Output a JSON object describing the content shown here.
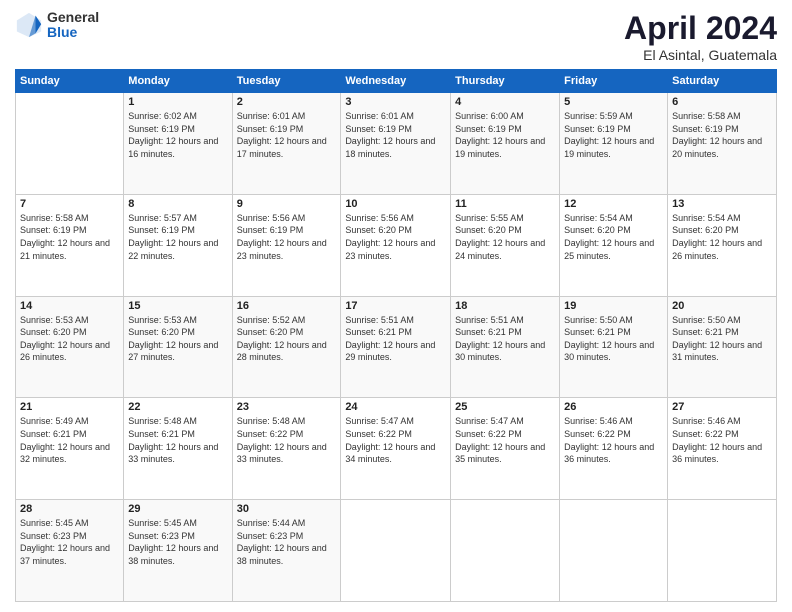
{
  "logo": {
    "general": "General",
    "blue": "Blue"
  },
  "header": {
    "title": "April 2024",
    "location": "El Asintal, Guatemala"
  },
  "weekdays": [
    "Sunday",
    "Monday",
    "Tuesday",
    "Wednesday",
    "Thursday",
    "Friday",
    "Saturday"
  ],
  "weeks": [
    [
      {
        "day": "",
        "sunrise": "",
        "sunset": "",
        "daylight": ""
      },
      {
        "day": "1",
        "sunrise": "Sunrise: 6:02 AM",
        "sunset": "Sunset: 6:19 PM",
        "daylight": "Daylight: 12 hours and 16 minutes."
      },
      {
        "day": "2",
        "sunrise": "Sunrise: 6:01 AM",
        "sunset": "Sunset: 6:19 PM",
        "daylight": "Daylight: 12 hours and 17 minutes."
      },
      {
        "day": "3",
        "sunrise": "Sunrise: 6:01 AM",
        "sunset": "Sunset: 6:19 PM",
        "daylight": "Daylight: 12 hours and 18 minutes."
      },
      {
        "day": "4",
        "sunrise": "Sunrise: 6:00 AM",
        "sunset": "Sunset: 6:19 PM",
        "daylight": "Daylight: 12 hours and 19 minutes."
      },
      {
        "day": "5",
        "sunrise": "Sunrise: 5:59 AM",
        "sunset": "Sunset: 6:19 PM",
        "daylight": "Daylight: 12 hours and 19 minutes."
      },
      {
        "day": "6",
        "sunrise": "Sunrise: 5:58 AM",
        "sunset": "Sunset: 6:19 PM",
        "daylight": "Daylight: 12 hours and 20 minutes."
      }
    ],
    [
      {
        "day": "7",
        "sunrise": "Sunrise: 5:58 AM",
        "sunset": "Sunset: 6:19 PM",
        "daylight": "Daylight: 12 hours and 21 minutes."
      },
      {
        "day": "8",
        "sunrise": "Sunrise: 5:57 AM",
        "sunset": "Sunset: 6:19 PM",
        "daylight": "Daylight: 12 hours and 22 minutes."
      },
      {
        "day": "9",
        "sunrise": "Sunrise: 5:56 AM",
        "sunset": "Sunset: 6:19 PM",
        "daylight": "Daylight: 12 hours and 23 minutes."
      },
      {
        "day": "10",
        "sunrise": "Sunrise: 5:56 AM",
        "sunset": "Sunset: 6:20 PM",
        "daylight": "Daylight: 12 hours and 23 minutes."
      },
      {
        "day": "11",
        "sunrise": "Sunrise: 5:55 AM",
        "sunset": "Sunset: 6:20 PM",
        "daylight": "Daylight: 12 hours and 24 minutes."
      },
      {
        "day": "12",
        "sunrise": "Sunrise: 5:54 AM",
        "sunset": "Sunset: 6:20 PM",
        "daylight": "Daylight: 12 hours and 25 minutes."
      },
      {
        "day": "13",
        "sunrise": "Sunrise: 5:54 AM",
        "sunset": "Sunset: 6:20 PM",
        "daylight": "Daylight: 12 hours and 26 minutes."
      }
    ],
    [
      {
        "day": "14",
        "sunrise": "Sunrise: 5:53 AM",
        "sunset": "Sunset: 6:20 PM",
        "daylight": "Daylight: 12 hours and 26 minutes."
      },
      {
        "day": "15",
        "sunrise": "Sunrise: 5:53 AM",
        "sunset": "Sunset: 6:20 PM",
        "daylight": "Daylight: 12 hours and 27 minutes."
      },
      {
        "day": "16",
        "sunrise": "Sunrise: 5:52 AM",
        "sunset": "Sunset: 6:20 PM",
        "daylight": "Daylight: 12 hours and 28 minutes."
      },
      {
        "day": "17",
        "sunrise": "Sunrise: 5:51 AM",
        "sunset": "Sunset: 6:21 PM",
        "daylight": "Daylight: 12 hours and 29 minutes."
      },
      {
        "day": "18",
        "sunrise": "Sunrise: 5:51 AM",
        "sunset": "Sunset: 6:21 PM",
        "daylight": "Daylight: 12 hours and 30 minutes."
      },
      {
        "day": "19",
        "sunrise": "Sunrise: 5:50 AM",
        "sunset": "Sunset: 6:21 PM",
        "daylight": "Daylight: 12 hours and 30 minutes."
      },
      {
        "day": "20",
        "sunrise": "Sunrise: 5:50 AM",
        "sunset": "Sunset: 6:21 PM",
        "daylight": "Daylight: 12 hours and 31 minutes."
      }
    ],
    [
      {
        "day": "21",
        "sunrise": "Sunrise: 5:49 AM",
        "sunset": "Sunset: 6:21 PM",
        "daylight": "Daylight: 12 hours and 32 minutes."
      },
      {
        "day": "22",
        "sunrise": "Sunrise: 5:48 AM",
        "sunset": "Sunset: 6:21 PM",
        "daylight": "Daylight: 12 hours and 33 minutes."
      },
      {
        "day": "23",
        "sunrise": "Sunrise: 5:48 AM",
        "sunset": "Sunset: 6:22 PM",
        "daylight": "Daylight: 12 hours and 33 minutes."
      },
      {
        "day": "24",
        "sunrise": "Sunrise: 5:47 AM",
        "sunset": "Sunset: 6:22 PM",
        "daylight": "Daylight: 12 hours and 34 minutes."
      },
      {
        "day": "25",
        "sunrise": "Sunrise: 5:47 AM",
        "sunset": "Sunset: 6:22 PM",
        "daylight": "Daylight: 12 hours and 35 minutes."
      },
      {
        "day": "26",
        "sunrise": "Sunrise: 5:46 AM",
        "sunset": "Sunset: 6:22 PM",
        "daylight": "Daylight: 12 hours and 36 minutes."
      },
      {
        "day": "27",
        "sunrise": "Sunrise: 5:46 AM",
        "sunset": "Sunset: 6:22 PM",
        "daylight": "Daylight: 12 hours and 36 minutes."
      }
    ],
    [
      {
        "day": "28",
        "sunrise": "Sunrise: 5:45 AM",
        "sunset": "Sunset: 6:23 PM",
        "daylight": "Daylight: 12 hours and 37 minutes."
      },
      {
        "day": "29",
        "sunrise": "Sunrise: 5:45 AM",
        "sunset": "Sunset: 6:23 PM",
        "daylight": "Daylight: 12 hours and 38 minutes."
      },
      {
        "day": "30",
        "sunrise": "Sunrise: 5:44 AM",
        "sunset": "Sunset: 6:23 PM",
        "daylight": "Daylight: 12 hours and 38 minutes."
      },
      {
        "day": "",
        "sunrise": "",
        "sunset": "",
        "daylight": ""
      },
      {
        "day": "",
        "sunrise": "",
        "sunset": "",
        "daylight": ""
      },
      {
        "day": "",
        "sunrise": "",
        "sunset": "",
        "daylight": ""
      },
      {
        "day": "",
        "sunrise": "",
        "sunset": "",
        "daylight": ""
      }
    ]
  ]
}
